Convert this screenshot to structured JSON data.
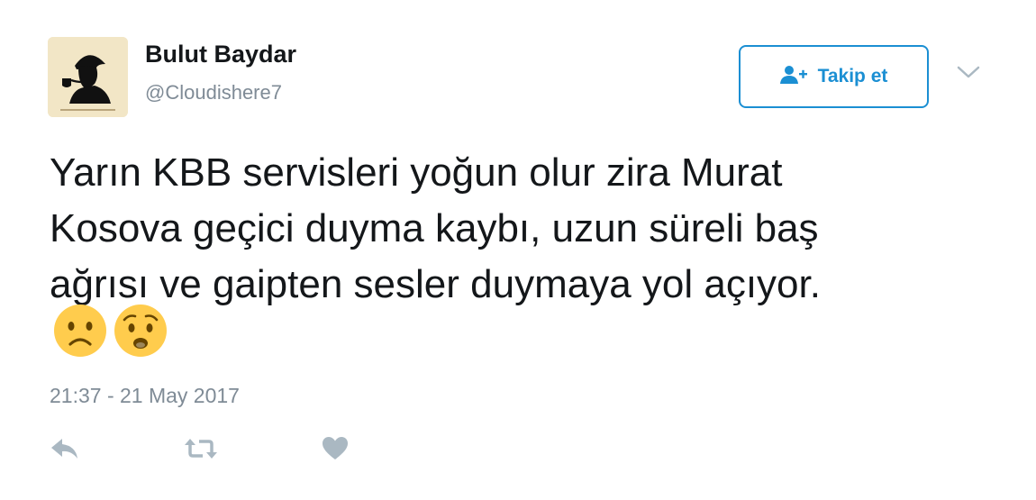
{
  "author": {
    "name": "Bulut Baydar",
    "handle": "@Cloudishere7",
    "avatar_icon": "silhouette-pipe-avatar-icon"
  },
  "follow_button": {
    "label": "Takip et",
    "icon": "add-user-icon",
    "color": "#1b8fd3"
  },
  "menu_icon": "chevron-down-icon",
  "tweet": {
    "lines": [
      "Yarın KBB servisleri yoğun olur zira Murat",
      "Kosova geçici duyma kaybı, uzun süreli baş",
      "ağrısı ve gaipten sesler duymaya yol açıyor."
    ],
    "emojis": [
      "frowning-face-emoji",
      "worried-face-emoji"
    ],
    "timestamp": "21:37 - 21 May 2017"
  },
  "actions": [
    "reply-icon",
    "retweet-icon",
    "like-heart-icon"
  ]
}
